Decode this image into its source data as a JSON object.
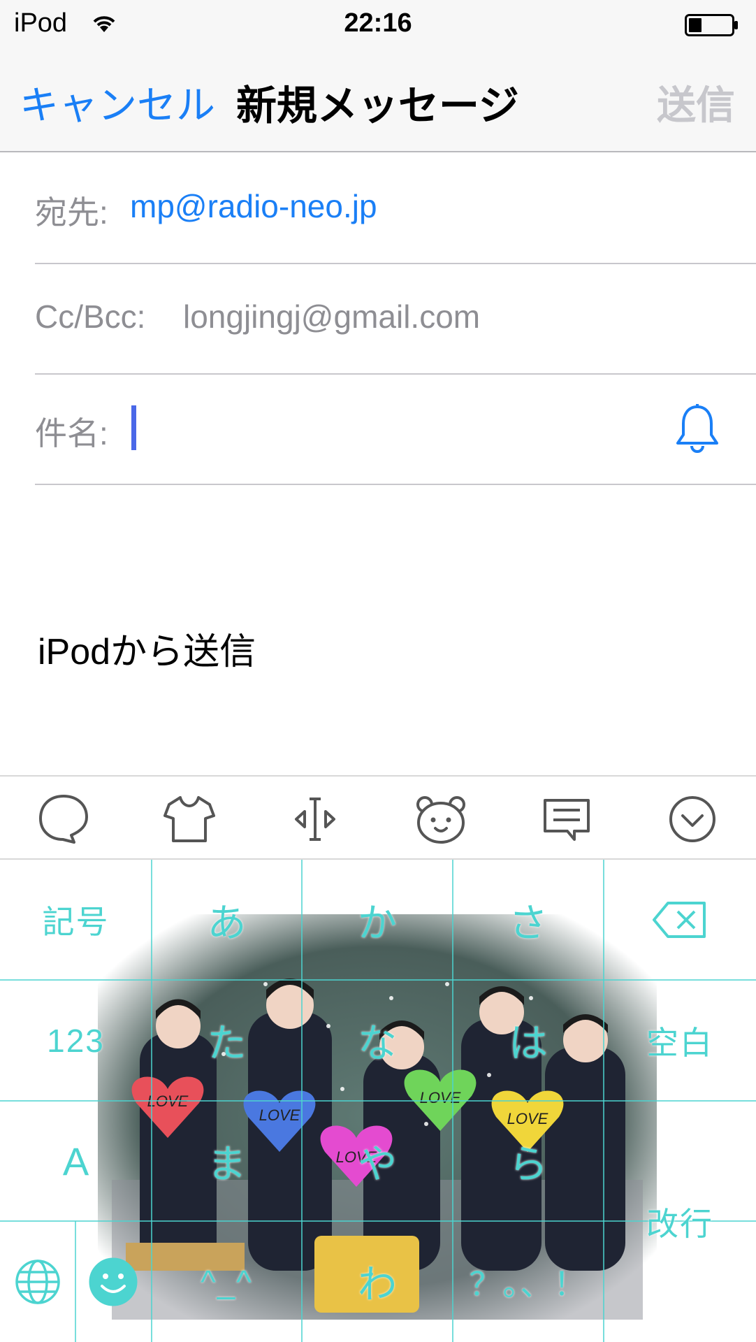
{
  "status_bar": {
    "carrier": "iPod",
    "time": "22:16"
  },
  "nav": {
    "cancel_label": "キャンセル",
    "title": "新規メッセージ",
    "send_label": "送信"
  },
  "fields": {
    "to_label": "宛先:",
    "to_value": "mp@radio-neo.jp",
    "cc_label": "Cc/Bcc:",
    "cc_value": "longjingj@gmail.com",
    "subject_label": "件名:"
  },
  "body": {
    "signature": "iPodから送信"
  },
  "toolbar": {
    "icons": [
      "chat-bubble-icon",
      "tshirt-icon",
      "cursor-move-icon",
      "bear-face-icon",
      "message-icon",
      "chevron-down-circle-icon"
    ]
  },
  "keyboard": {
    "keys": {
      "symbols": "記号",
      "a": "あ",
      "ka": "か",
      "sa": "さ",
      "numbers": "123",
      "ta": "た",
      "na": "な",
      "ha": "は",
      "space": "空白",
      "alpha": "A",
      "ma": "ま",
      "ya": "や",
      "ra": "ら",
      "kaomoji": "^_^",
      "wa": "わ",
      "punct": "？。、！",
      "return": "改行"
    },
    "photo_heart_labels": [
      "LOVE",
      "LOVE",
      "LOVE",
      "LOVE",
      "LOVE"
    ],
    "colors": {
      "key_text": "#4cd4d0",
      "grid_line": "#4cd4d0"
    }
  },
  "colors": {
    "accent": "#1a7ff6",
    "placeholder": "#8e8e93",
    "caret": "#4a68e8"
  }
}
